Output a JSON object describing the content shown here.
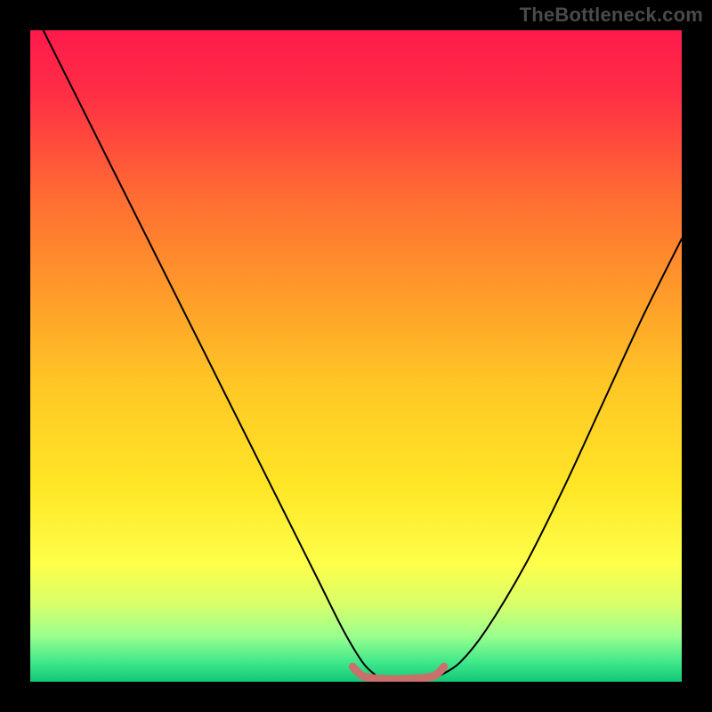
{
  "watermark": "TheBottleneck.com",
  "chart_data": {
    "type": "line",
    "title": "",
    "xlabel": "",
    "ylabel": "",
    "xlim": [
      0,
      100
    ],
    "ylim": [
      0,
      100
    ],
    "background_gradient": {
      "stops": [
        {
          "offset": 0.0,
          "color": "#ff1a4b"
        },
        {
          "offset": 0.1,
          "color": "#ff2f45"
        },
        {
          "offset": 0.25,
          "color": "#ff6a33"
        },
        {
          "offset": 0.4,
          "color": "#ff9a2a"
        },
        {
          "offset": 0.55,
          "color": "#ffc825"
        },
        {
          "offset": 0.7,
          "color": "#ffe626"
        },
        {
          "offset": 0.82,
          "color": "#fdff4a"
        },
        {
          "offset": 0.88,
          "color": "#d9ff6a"
        },
        {
          "offset": 0.93,
          "color": "#9bff8e"
        },
        {
          "offset": 0.97,
          "color": "#3fe88a"
        },
        {
          "offset": 1.0,
          "color": "#12c777"
        }
      ]
    },
    "series": [
      {
        "name": "left-branch",
        "color": "#000000",
        "x": [
          2,
          8,
          14,
          20,
          26,
          32,
          38,
          44,
          48,
          51,
          53
        ],
        "y": [
          100,
          88,
          76,
          64,
          52,
          40,
          28,
          16,
          8,
          3,
          1
        ]
      },
      {
        "name": "right-branch",
        "color": "#000000",
        "x": [
          63,
          66,
          70,
          76,
          82,
          88,
          94,
          100
        ],
        "y": [
          1,
          3,
          8,
          18,
          30,
          43,
          56,
          68
        ]
      },
      {
        "name": "valley-floor",
        "color": "#d46a6a",
        "x": [
          49.5,
          51,
          53,
          56,
          59,
          62,
          63.5
        ],
        "y": [
          2.3,
          0.9,
          0.5,
          0.4,
          0.5,
          0.9,
          2.3
        ]
      }
    ],
    "annotations": []
  }
}
